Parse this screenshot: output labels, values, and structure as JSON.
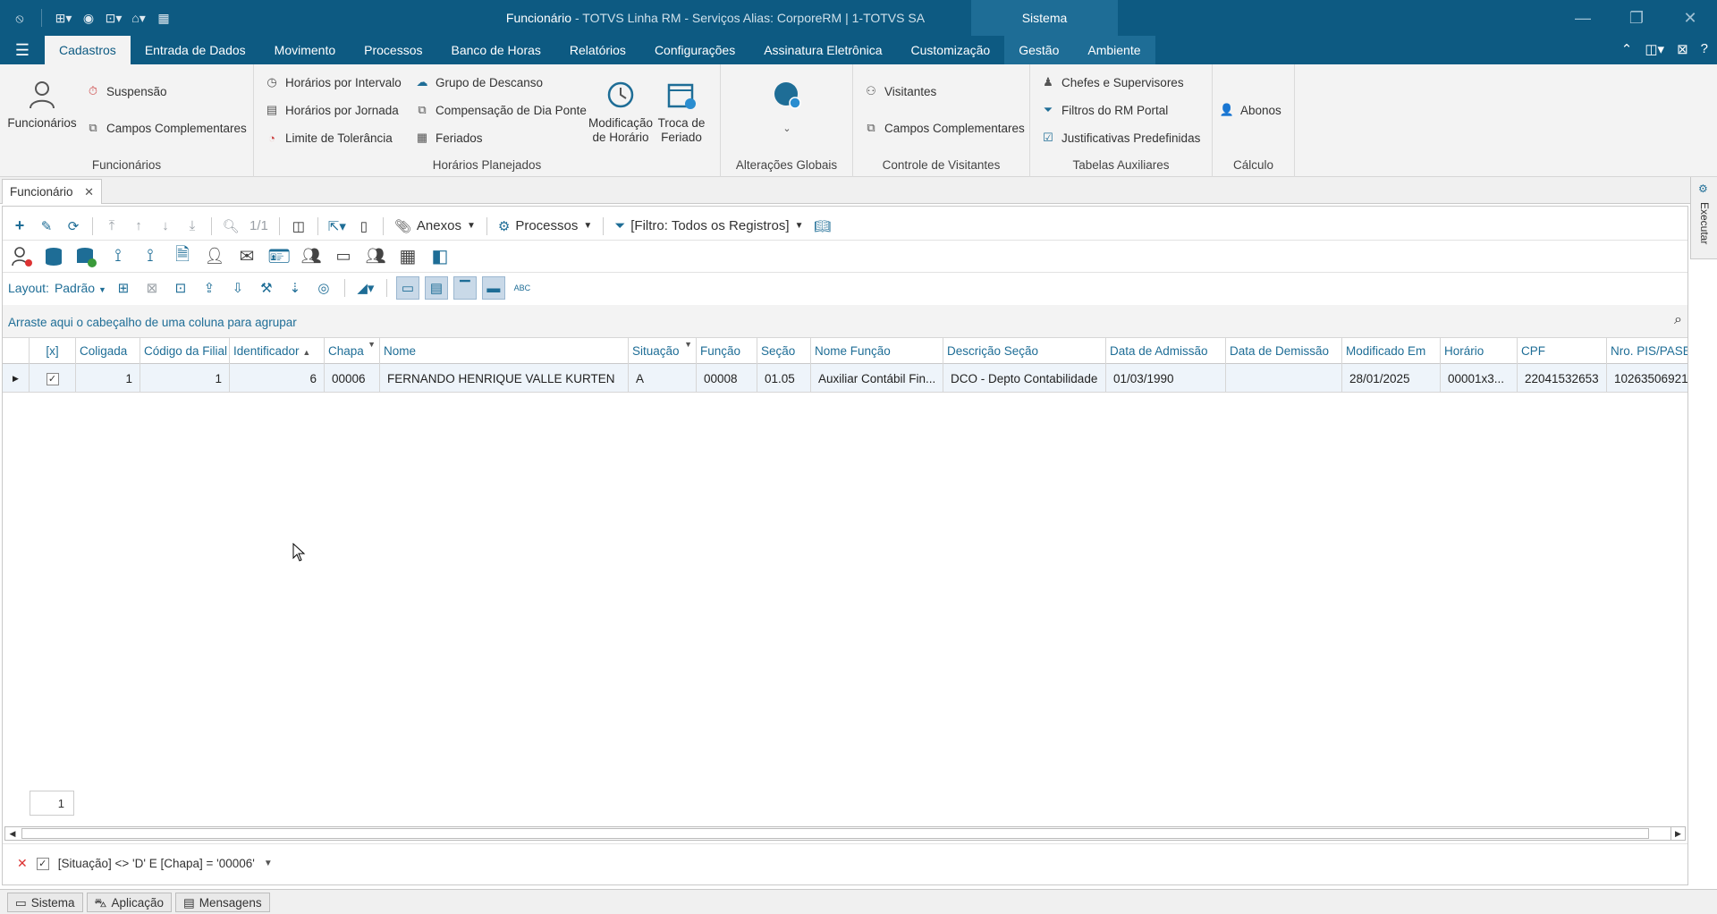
{
  "titlebar": {
    "title_main": "Funcionário",
    "title_rest": " - TOTVS Linha RM - Serviços  Alias: CorporeRM | 1-TOTVS SA",
    "contextual_tab": "Sistema"
  },
  "menu": {
    "tabs": [
      "Cadastros",
      "Entrada de Dados",
      "Movimento",
      "Processos",
      "Banco de Horas",
      "Relatórios",
      "Configurações",
      "Assinatura Eletrônica",
      "Customização",
      "Gestão",
      "Ambiente"
    ]
  },
  "ribbon": {
    "funcionarios": {
      "big": "Funcionários",
      "suspensao": "Suspensão",
      "campos": "Campos Complementares",
      "title": "Funcionários"
    },
    "horarios": {
      "intervalo": "Horários por Intervalo",
      "jornada": "Horários por Jornada",
      "tolerancia": "Limite de Tolerância",
      "descanso": "Grupo de Descanso",
      "compensacao": "Compensação de Dia Ponte",
      "feriados": "Feriados",
      "modificacao_l1": "Modificação",
      "modificacao_l2": "de Horário",
      "troca_l1": "Troca de",
      "troca_l2": "Feriado",
      "title": "Horários Planejados"
    },
    "alteracoes": {
      "title": "Alterações Globais"
    },
    "visitantes": {
      "visitantes": "Visitantes",
      "campos": "Campos Complementares",
      "title": "Controle de Visitantes"
    },
    "auxiliares": {
      "chefes": "Chefes e Supervisores",
      "filtros": "Filtros do RM Portal",
      "justificativas": "Justificativas Predefinidas",
      "title": "Tabelas Auxiliares"
    },
    "calculo": {
      "abonos": "Abonos",
      "title": "Cálculo"
    }
  },
  "doc_tab": {
    "label": "Funcionário"
  },
  "side_panel": {
    "label": "Executar"
  },
  "toolbar": {
    "record_count": "1/1",
    "anexos": "Anexos",
    "processos": "Processos",
    "filtro": "[Filtro: Todos os Registros]",
    "layout_label": "Layout:",
    "layout_value": "Padrão"
  },
  "groupbar": {
    "hint": "Arraste aqui o cabeçalho de uma coluna para agrupar"
  },
  "grid": {
    "columns": [
      "[x]",
      "Coligada",
      "Código da Filial",
      "Identificador",
      "Chapa",
      "Nome",
      "Situação",
      "Função",
      "Seção",
      "Nome Função",
      "Descrição Seção",
      "Data de Admissão",
      "Data de Demissão",
      "Modificado Em",
      "Horário",
      "CPF",
      "Nro. PIS/PASEP"
    ],
    "rows": [
      {
        "coligada": "1",
        "filial": "1",
        "identificador": "6",
        "chapa": "00006",
        "nome": "FERNANDO HENRIQUE VALLE KURTEN",
        "situacao": "A",
        "funcao": "00008",
        "secao": "01.05",
        "nome_funcao": "Auxiliar Contábil Fin...",
        "descricao_secao": "DCO - Depto Contabilidade",
        "admissao": "01/03/1990",
        "demissao": "",
        "modificado": "28/01/2025",
        "horario": "00001x3...",
        "cpf": "22041532653",
        "pis": "10263506921"
      }
    ]
  },
  "pager": {
    "page": "1"
  },
  "filterbar": {
    "expression": "[Situação] <> 'D' E [Chapa] = '00006'"
  },
  "statusbar": {
    "sistema": "Sistema",
    "aplicacao": "Aplicação",
    "mensagens": "Mensagens"
  }
}
